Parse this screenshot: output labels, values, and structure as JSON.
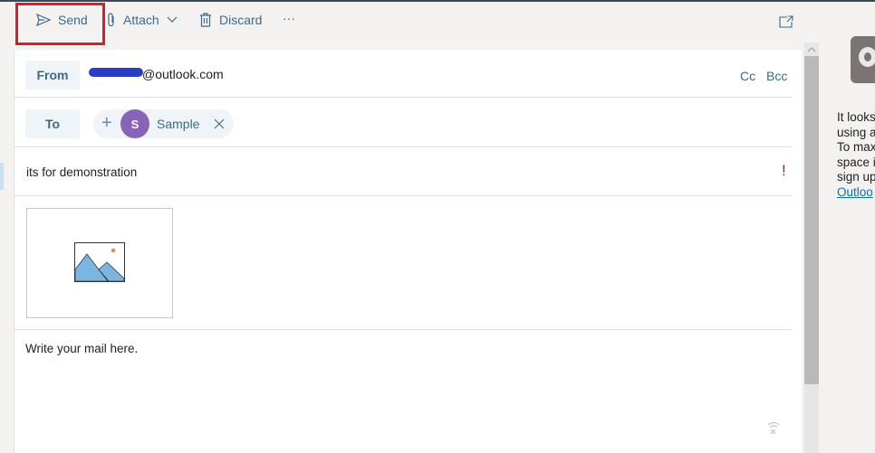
{
  "toolbar": {
    "send": "Send",
    "attach": "Attach",
    "discard": "Discard",
    "more": "···"
  },
  "from": {
    "label": "From",
    "address": "@outlook.com",
    "cc": "Cc",
    "bcc": "Bcc"
  },
  "to": {
    "label": "To",
    "recipient_initial": "S",
    "recipient_name": "Sample",
    "avatar_color": "#8764b8"
  },
  "subject": "its for demonstration",
  "importance": "!",
  "body": "Write your mail here.",
  "side_panel": {
    "lines": [
      "It looks",
      "using a",
      "To max",
      "space i",
      "sign up"
    ],
    "link": "Outloo"
  },
  "colors": {
    "accent": "#3b6a8a",
    "highlight": "#d1202a"
  }
}
